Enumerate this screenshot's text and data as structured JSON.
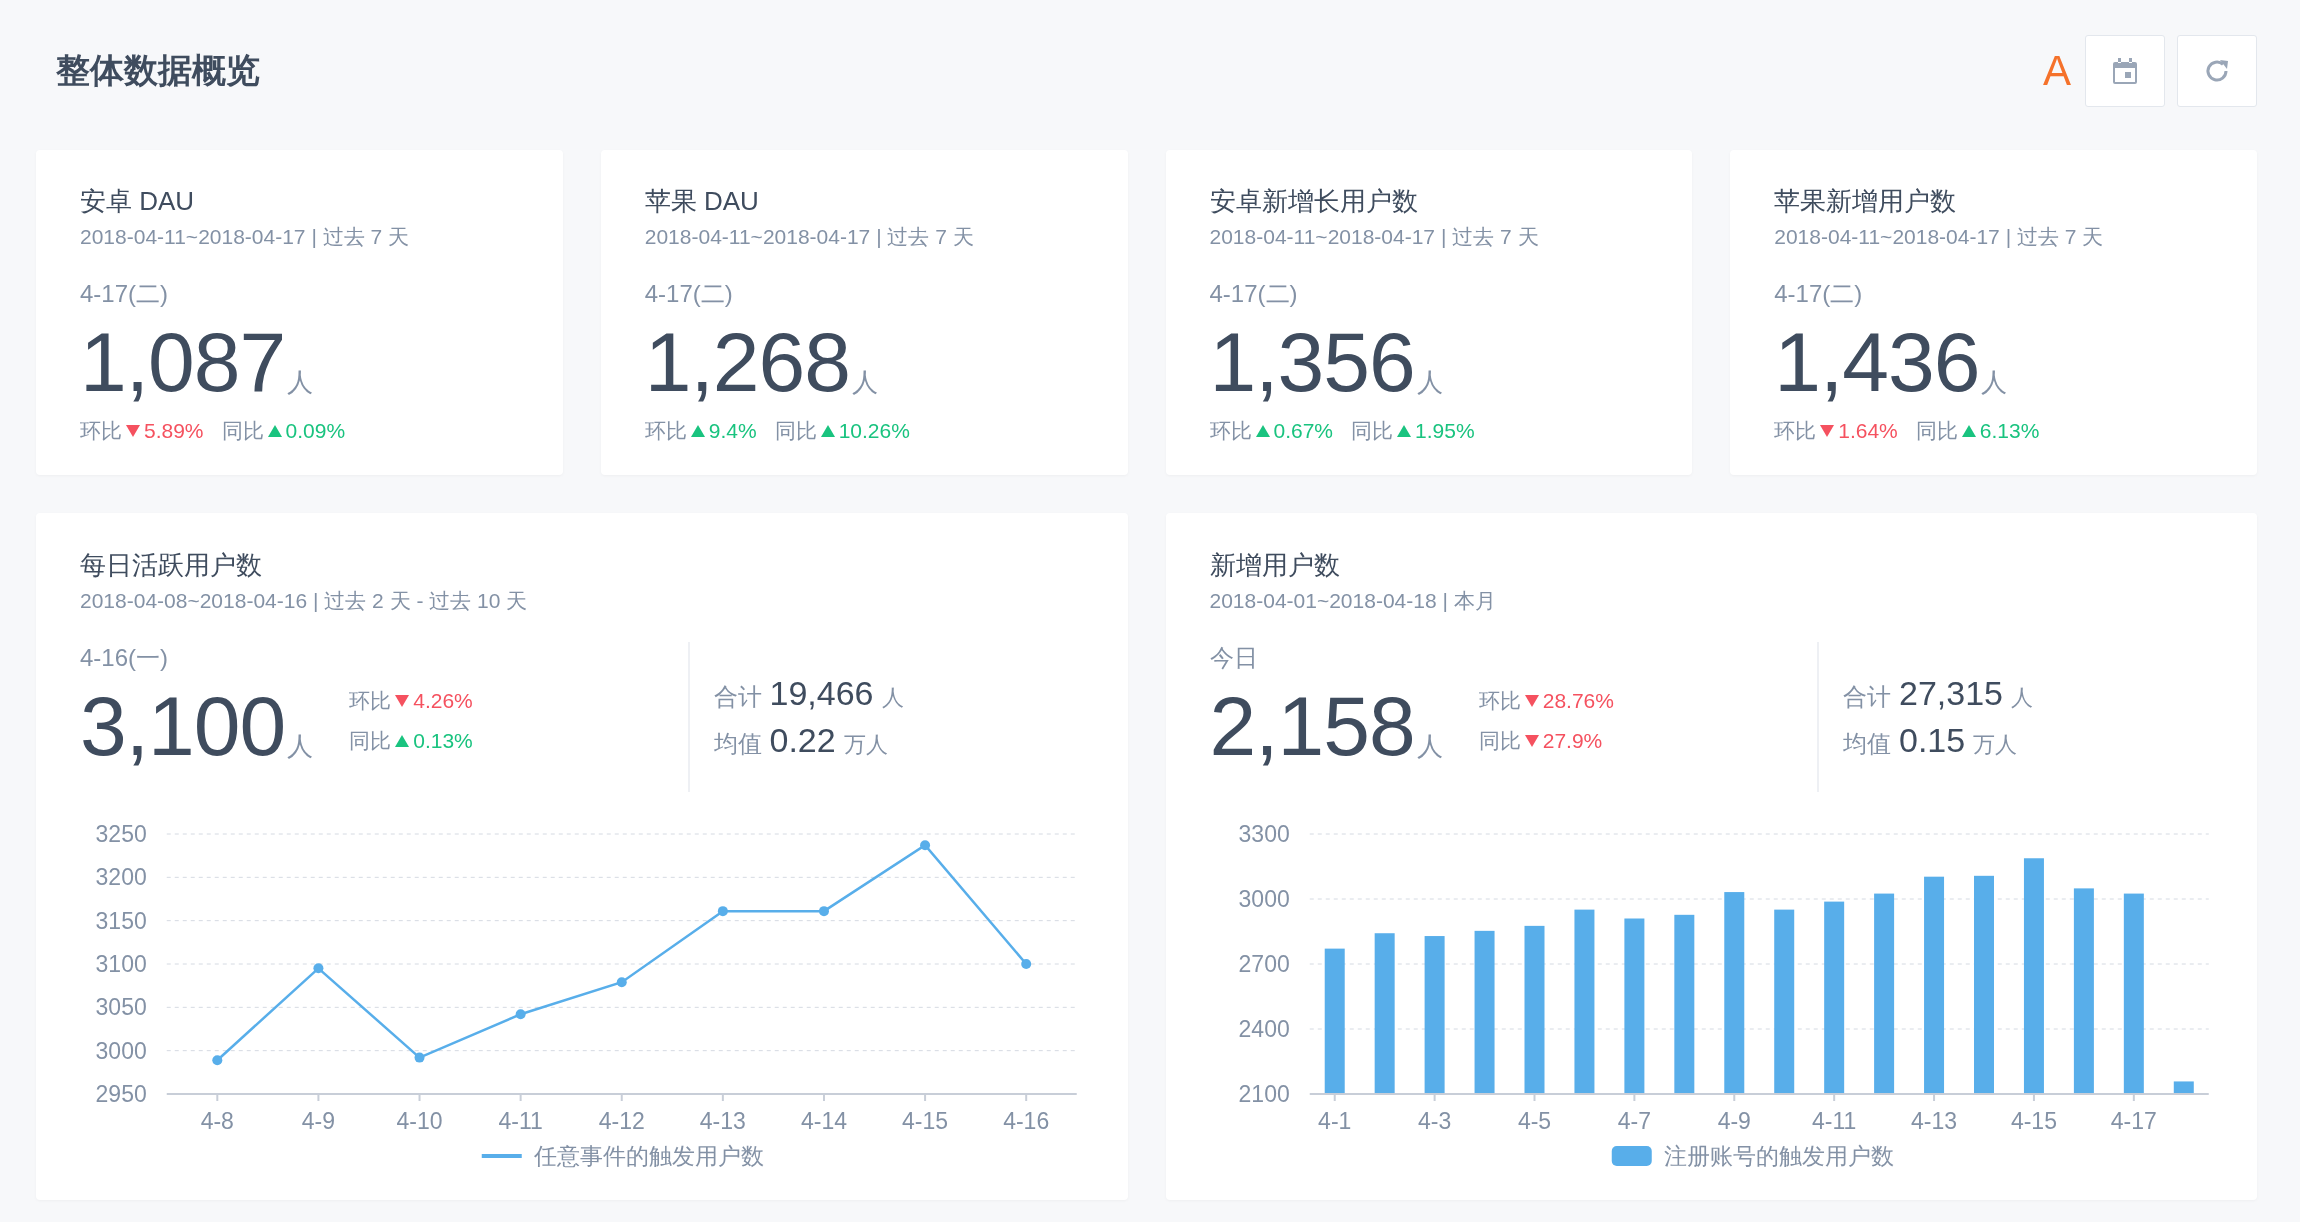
{
  "header": {
    "title": "整体数据概览",
    "buttons": [
      {
        "kind": "text",
        "label": "A"
      },
      {
        "kind": "calendar"
      },
      {
        "kind": "refresh"
      }
    ]
  },
  "kpi_cards": [
    {
      "title": "安卓 DAU",
      "range": "2018-04-11~2018-04-17 | 过去 7 天",
      "day": "4-17(二)",
      "value": "1,087",
      "unit": "人",
      "changes": [
        {
          "label": "环比",
          "value": "5.89%",
          "rising": false
        },
        {
          "label": "同比",
          "value": "0.09%",
          "rising": true
        }
      ]
    },
    {
      "title": "苹果 DAU",
      "range": "2018-04-11~2018-04-17 | 过去 7 天",
      "day": "4-17(二)",
      "value": "1,268",
      "unit": "人",
      "changes": [
        {
          "label": "环比",
          "value": "9.4%",
          "rising": true
        },
        {
          "label": "同比",
          "value": "10.26%",
          "rising": true
        }
      ]
    },
    {
      "title": "安卓新增长用户数",
      "range": "2018-04-11~2018-04-17 | 过去 7 天",
      "day": "4-17(二)",
      "value": "1,356",
      "unit": "人",
      "changes": [
        {
          "label": "环比",
          "value": "0.67%",
          "rising": true
        },
        {
          "label": "同比",
          "value": "1.95%",
          "rising": true
        }
      ]
    },
    {
      "title": "苹果新增用户数",
      "range": "2018-04-11~2018-04-17 | 过去 7 天",
      "day": "4-17(二)",
      "value": "1,436",
      "unit": "人",
      "changes": [
        {
          "label": "环比",
          "value": "1.64%",
          "rising": false
        },
        {
          "label": "同比",
          "value": "6.13%",
          "rising": true
        }
      ]
    }
  ],
  "chart_cards": [
    {
      "title": "每日活跃用户数",
      "range": "2018-04-08~2018-04-16 | 过去 2 天 - 过去 10 天",
      "day": "4-16(一)",
      "value": "3,100",
      "unit": "人",
      "changes": [
        {
          "label": "环比",
          "value": "4.26%",
          "rising": false
        },
        {
          "label": "同比",
          "value": "0.13%",
          "rising": true
        }
      ],
      "stats": [
        {
          "label": "合计",
          "value": "19,466",
          "unit": "人"
        },
        {
          "label": "均值",
          "value": "0.22",
          "unit": "万人"
        }
      ],
      "chart_data": {
        "type": "line",
        "categories": [
          "4-8",
          "4-9",
          "4-10",
          "4-11",
          "4-12",
          "4-13",
          "4-14",
          "4-15",
          "4-16"
        ],
        "ylim": [
          2950,
          3250
        ],
        "yticks": [
          2950,
          3000,
          3050,
          3100,
          3150,
          3200,
          3250
        ],
        "grid": true,
        "series": [
          {
            "name": "任意事件的触发用户数",
            "color": "#58aeea",
            "marker": "circle",
            "values": [
              2989,
              3095,
              2992,
              3042,
              3079,
              3161,
              3161,
              3237,
              3100
            ]
          }
        ]
      }
    },
    {
      "title": "新增用户数",
      "range": "2018-04-01~2018-04-18 | 本月",
      "day": "今日",
      "value": "2,158",
      "unit": "人",
      "changes": [
        {
          "label": "环比",
          "value": "28.76%",
          "rising": false
        },
        {
          "label": "同比",
          "value": "27.9%",
          "rising": false
        }
      ],
      "stats": [
        {
          "label": "合计",
          "value": "27,315",
          "unit": "人"
        },
        {
          "label": "均值",
          "value": "0.15",
          "unit": "万人"
        }
      ],
      "chart_data": {
        "type": "bar",
        "ylim": [
          2100,
          3300
        ],
        "yticks": [
          2100,
          2400,
          2700,
          3000,
          3300
        ],
        "grid": true,
        "categories": [
          "4-1",
          null,
          "4-3",
          null,
          "4-5",
          null,
          "4-7",
          null,
          "4-9",
          null,
          "4-11",
          null,
          "4-13",
          null,
          "4-15",
          null,
          "4-17",
          null
        ],
        "series": [
          {
            "name": "注册账号的触发用户数",
            "color": "#58aeea",
            "values": [
              2771,
              2842,
              2829,
              2853,
              2876,
              2951,
              2910,
              2927,
              3032,
              2951,
              2988,
              3025,
              3103,
              3107,
              3188,
              3049,
              3025,
              2158
            ]
          }
        ]
      }
    }
  ]
}
